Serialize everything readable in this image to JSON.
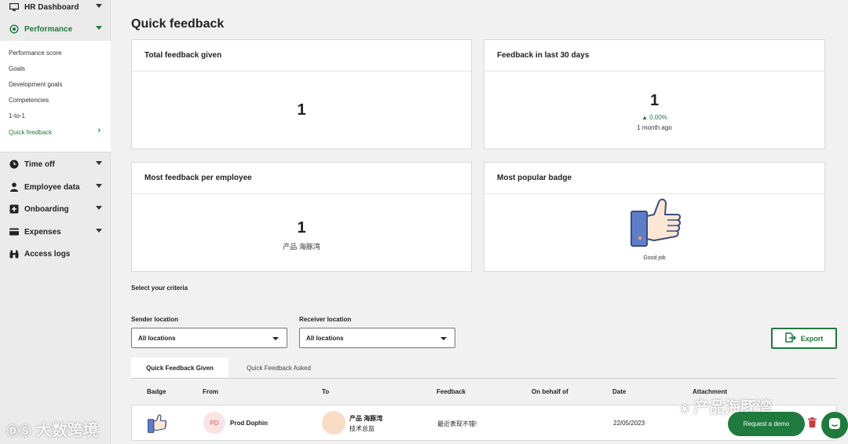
{
  "sidebar": {
    "hr_dashboard": "HR Dashboard",
    "performance": "Performance",
    "sub_items": [
      "Performance score",
      "Goals",
      "Development goals",
      "Competencies",
      "1-to-1",
      "Quick feedback"
    ],
    "time_off": "Time off",
    "employee_data": "Employee data",
    "onboarding": "Onboarding",
    "expenses": "Expenses",
    "access_logs": "Access logs"
  },
  "page": {
    "title": "Quick feedback"
  },
  "cards": {
    "total": {
      "title": "Total feedback given",
      "value": "1"
    },
    "last30": {
      "title": "Feedback in last 30 days",
      "value": "1",
      "trend": "0.00%",
      "ago": "1 month ago"
    },
    "per_employee": {
      "title": "Most feedback per employee",
      "value": "1",
      "employee": "产品 海豚湾"
    },
    "badge": {
      "title": "Most popular badge",
      "badge_name": "Good job"
    }
  },
  "criteria": {
    "title": "Select your criteria",
    "sender_label": "Sender location",
    "sender_value": "All locations",
    "receiver_label": "Receiver location",
    "receiver_value": "All locations"
  },
  "export_label": "Export",
  "tabs": [
    "Quick Feedback Given",
    "Quick Feedback Asked"
  ],
  "table": {
    "headers": [
      "Badge",
      "From",
      "To",
      "Feedback",
      "On behalf of",
      "Date",
      "Attachment"
    ],
    "rows": [
      {
        "from_initials": "PD",
        "from": "Prod Dophin",
        "to_name": "产品 海豚湾",
        "to_title": "技术总监",
        "feedback": "最近表现不错!",
        "on_behalf": "",
        "date": "22/05/2023"
      }
    ]
  },
  "watermarks": {
    "left": "大数跨境",
    "right": "产品海豚湾"
  },
  "request_demo": "Request a demo",
  "colors": {
    "accent": "#1f7a3d",
    "delete": "#d13b3b"
  }
}
